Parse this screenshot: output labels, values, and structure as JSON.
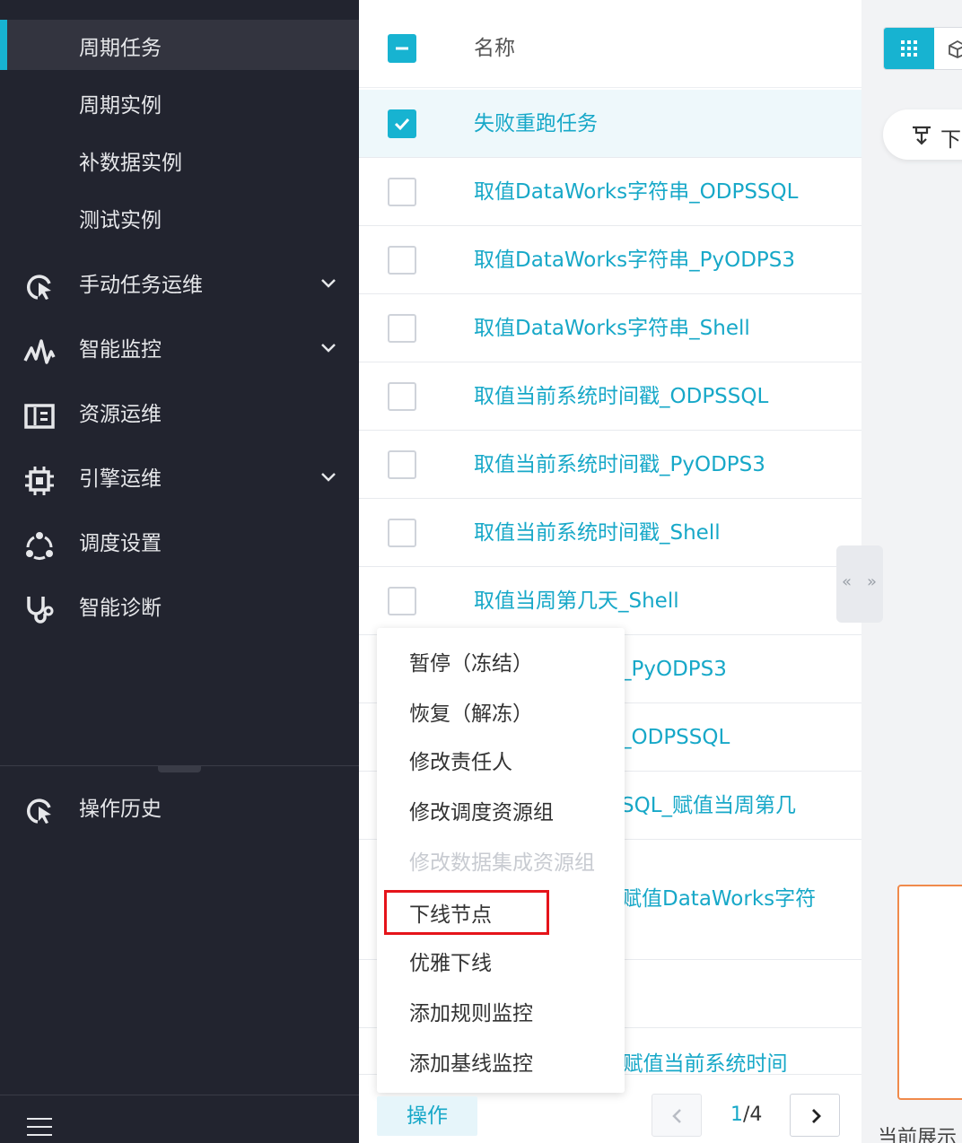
{
  "sidebar": {
    "sub_items": [
      "周期任务",
      "周期实例",
      "补数据实例",
      "测试实例"
    ],
    "items": [
      {
        "label": "手动任务运维",
        "icon": "cursor-refresh-icon",
        "has_chevron": true
      },
      {
        "label": "智能监控",
        "icon": "pulse-icon",
        "has_chevron": true
      },
      {
        "label": "资源运维",
        "icon": "resource-panel-icon",
        "has_chevron": false
      },
      {
        "label": "引擎运维",
        "icon": "chip-icon",
        "has_chevron": true
      },
      {
        "label": "调度设置",
        "icon": "network-nodes-icon",
        "has_chevron": false
      },
      {
        "label": "智能诊断",
        "icon": "stethoscope-icon",
        "has_chevron": false
      }
    ],
    "history": {
      "label": "操作历史",
      "icon": "cursor-refresh-icon"
    },
    "accent": "#17b3d1"
  },
  "table": {
    "header": "名称",
    "rows": [
      {
        "name": "失败重跑任务",
        "checked": true
      },
      {
        "name": "取值DataWorks字符串_ODPSSQL",
        "checked": false
      },
      {
        "name": "取值DataWorks字符串_PyODPS3",
        "checked": false
      },
      {
        "name": "取值DataWorks字符串_Shell",
        "checked": false
      },
      {
        "name": "取值当前系统时间戳_ODPSSQL",
        "checked": false
      },
      {
        "name": "取值当前系统时间戳_PyODPS3",
        "checked": false
      },
      {
        "name": "取值当前系统时间戳_Shell",
        "checked": false
      },
      {
        "name": "取值当周第几天_Shell",
        "checked": false
      },
      {
        "name": "_PyODPS3",
        "checked": false
      },
      {
        "name": "_ODPSSQL",
        "checked": false
      },
      {
        "name": "SQL_赋值当周第几",
        "checked": false
      },
      {
        "name": "赋值DataWorks字符",
        "checked": false
      },
      {
        "name": "",
        "checked": false
      },
      {
        "name": "_赋值当前系统时间",
        "checked": false
      }
    ]
  },
  "dropdown": {
    "items": [
      {
        "label": "暂停（冻结）",
        "disabled": false
      },
      {
        "label": "恢复（解冻）",
        "disabled": false
      },
      {
        "label": "修改责任人",
        "disabled": false
      },
      {
        "label": "修改调度资源组",
        "disabled": false
      },
      {
        "label": "修改数据集成资源组",
        "disabled": true
      },
      {
        "label": "下线节点",
        "disabled": false,
        "highlighted": true
      },
      {
        "label": "优雅下线",
        "disabled": false
      },
      {
        "label": "添加规则监控",
        "disabled": false
      },
      {
        "label": "添加基线监控",
        "disabled": false
      }
    ]
  },
  "footer": {
    "op_button": "操作",
    "page_current": "1",
    "page_total": "/4"
  },
  "right_panel": {
    "download_label": "下",
    "bottom_caption": "当前展示"
  }
}
